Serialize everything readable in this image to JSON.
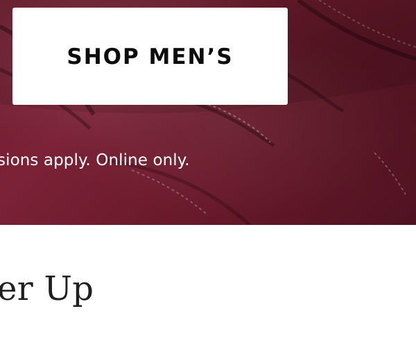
{
  "hero": {
    "button_label": "SHOP MEN’S",
    "promo_text": "sions apply. Online only."
  },
  "section": {
    "headline": "er Up"
  },
  "colors": {
    "leather": "#6f1a2d",
    "button_background": "#ffffff",
    "button_text": "#0c0c0c",
    "promo_text": "#ffffff",
    "headline_text": "#1f1f1f"
  }
}
